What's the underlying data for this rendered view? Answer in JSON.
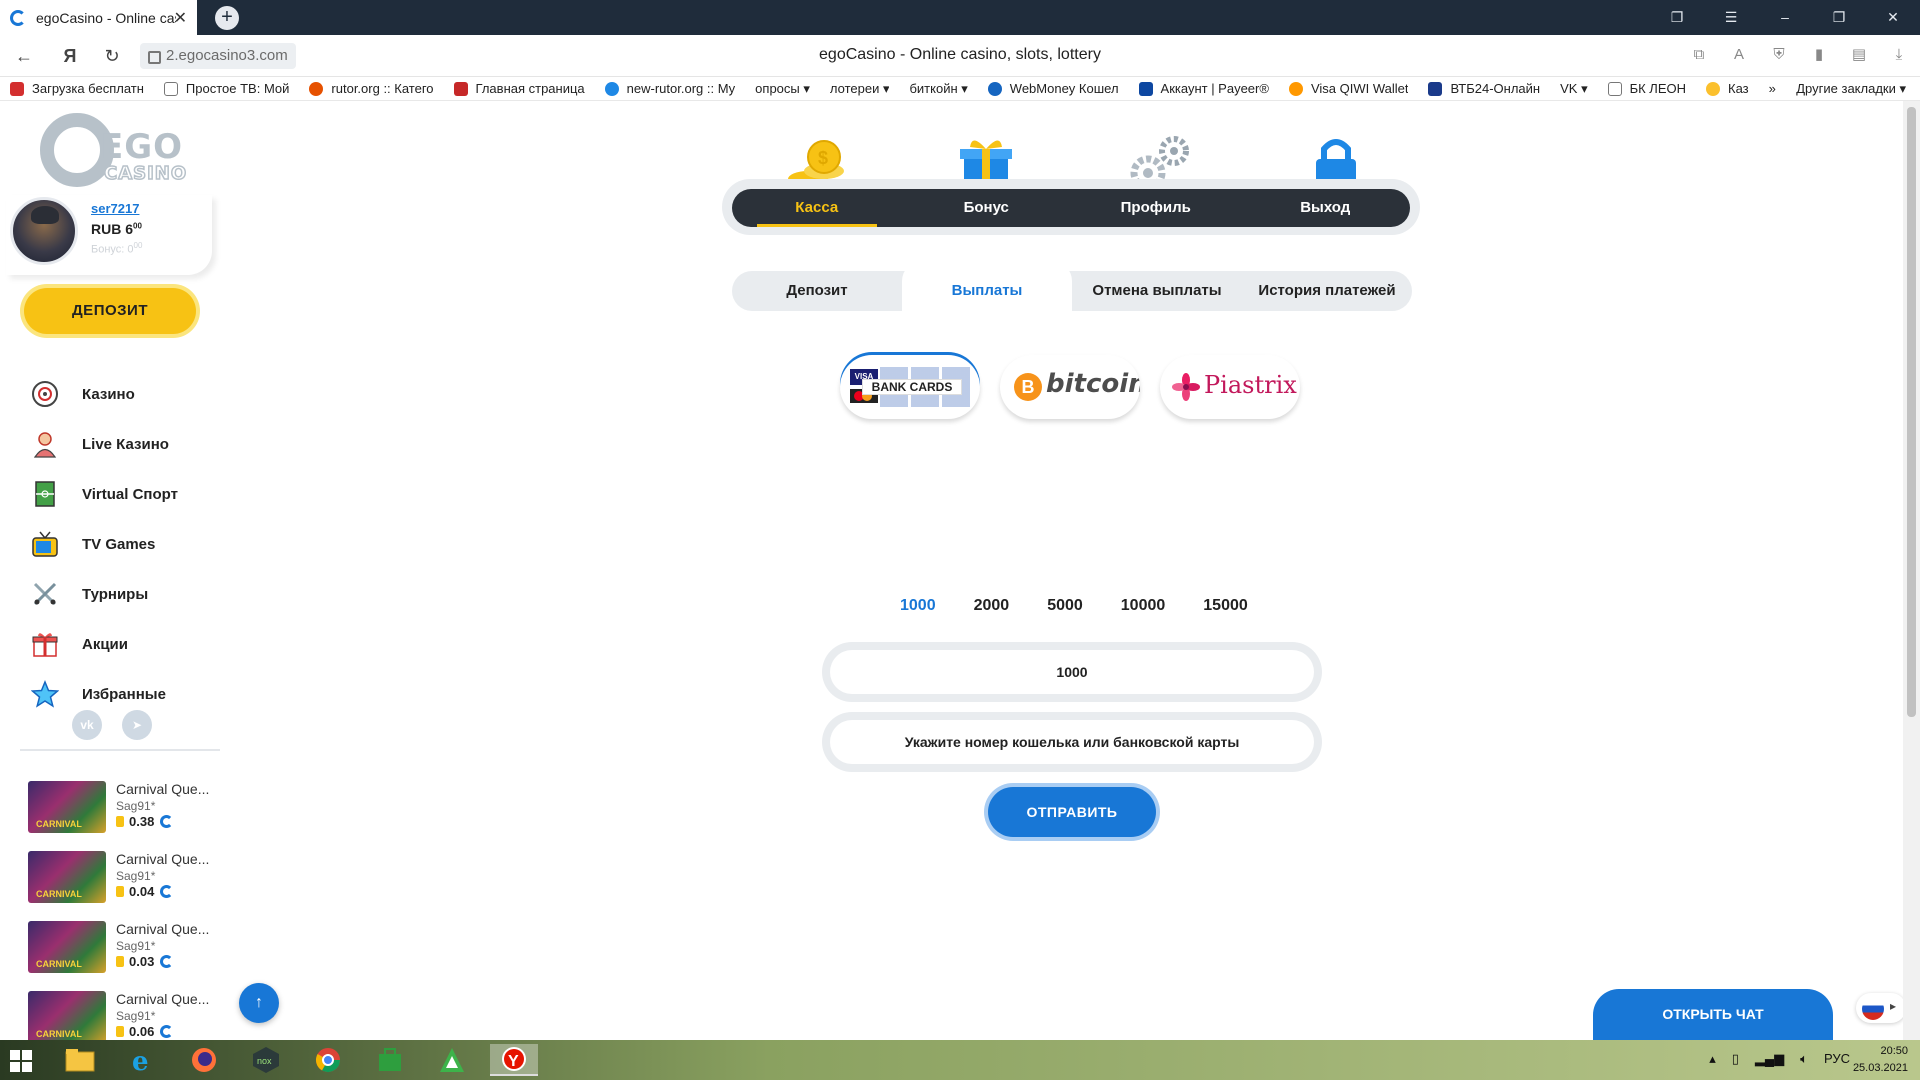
{
  "browser": {
    "tab_title": "egoCasino - Online casi",
    "url": "2.egocasino3.com",
    "page_title": "egoCasino - Online casino, slots, lottery",
    "bookmarks": [
      "Загрузка бесплатн",
      "Простое ТВ: Мой",
      "rutor.org :: Катего",
      "Главная страница",
      "new-rutor.org :: Му",
      "опросы ▾",
      "лотереи ▾",
      "биткойн ▾",
      "WebMoney Кошел",
      "Аккаунт | Payeer®",
      "Visa QIWI Wallet",
      "ВТБ24-Онлайн",
      "VK ▾",
      "БК ЛЕОН",
      "Каз"
    ],
    "bookmarks_other": "Другие закладки ▾",
    "nav_back": "←",
    "nav_ya": "Я",
    "nav_reload": "↻"
  },
  "sidebar": {
    "logo_main": "EGO",
    "logo_sub": "CASINO",
    "user": {
      "name": "ser7217",
      "balance": "RUB 6",
      "balance_cents": "00",
      "bonus": "Бонус: 0",
      "bonus_cents": "00"
    },
    "deposit_label": "ДЕПОЗИТ",
    "menu": [
      {
        "label": "Казино",
        "icon": "roulette-icon"
      },
      {
        "label": "Live Казино",
        "icon": "dealer-icon"
      },
      {
        "label": "Virtual Спорт",
        "icon": "field-icon"
      },
      {
        "label": "TV Games",
        "icon": "tv-icon"
      },
      {
        "label": "Турниры",
        "icon": "swords-icon"
      },
      {
        "label": "Акции",
        "icon": "gift-icon"
      },
      {
        "label": "Избранные",
        "icon": "star-icon"
      }
    ],
    "socials": [
      "vk",
      "telegram"
    ],
    "wins": [
      {
        "game": "Carnival Que...",
        "user": "Sag91*",
        "amount": "0.38"
      },
      {
        "game": "Carnival Que...",
        "user": "Sag91*",
        "amount": "0.04"
      },
      {
        "game": "Carnival Que...",
        "user": "Sag91*",
        "amount": "0.03"
      },
      {
        "game": "Carnival Que...",
        "user": "Sag91*",
        "amount": "0.06"
      }
    ]
  },
  "cashier": {
    "top_nav": [
      "Касса",
      "Бонус",
      "Профиль",
      "Выход"
    ],
    "sub_tabs": [
      "Депозит",
      "Выплаты",
      "Отмена выплаты",
      "История платежей"
    ],
    "methods": {
      "bank_cards": "BANK CARDS",
      "visa": "VISA",
      "bitcoin": "bitcoin",
      "btc_symbol": "B",
      "piastrix": "Piastrix"
    },
    "amount_options": [
      "1000",
      "2000",
      "5000",
      "10000",
      "15000"
    ],
    "amount_value": "1000",
    "wallet_placeholder": "Укажите номер кошелька или банковской карты",
    "submit_label": "ОТПРАВИТЬ"
  },
  "chat_label": "ОТКРЫТЬ ЧАТ",
  "taskbar": {
    "lang": "РУС",
    "time": "20:50",
    "date": "25.03.2021"
  },
  "colors": {
    "accent_blue": "#1877d6",
    "accent_yellow": "#f7c214",
    "nav_dark": "#2b3139"
  }
}
